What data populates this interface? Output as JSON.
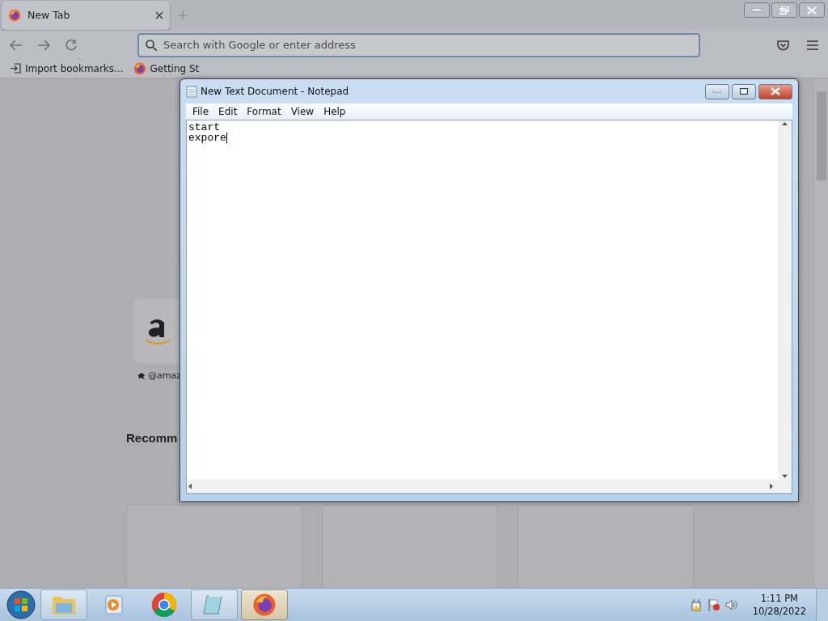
{
  "browser": {
    "tabs": [
      {
        "title": "New Tab",
        "selected": true
      }
    ],
    "address_bar": {
      "placeholder": "Search with Google or enter address"
    },
    "bookmarks": [
      {
        "label": "Import bookmarks...",
        "kind": "import"
      },
      {
        "label": "Getting St",
        "kind": "firefox"
      }
    ],
    "page": {
      "shortcut_label": "@amaz",
      "section_heading": "Recomm"
    }
  },
  "notepad": {
    "title": "New Text Document - Notepad",
    "menu": [
      "File",
      "Edit",
      "Format",
      "View",
      "Help"
    ],
    "text": "start\nexpore"
  },
  "taskbar": {
    "items": [
      {
        "kind": "folder",
        "running": true,
        "selected": false
      },
      {
        "kind": "media",
        "running": false,
        "selected": false
      },
      {
        "kind": "chrome",
        "running": false,
        "selected": false
      },
      {
        "kind": "notepad",
        "running": true,
        "selected": false
      },
      {
        "kind": "firefox",
        "running": true,
        "selected": true
      }
    ],
    "clock": {
      "time": "1:11 PM",
      "date": "10/28/2022"
    }
  }
}
